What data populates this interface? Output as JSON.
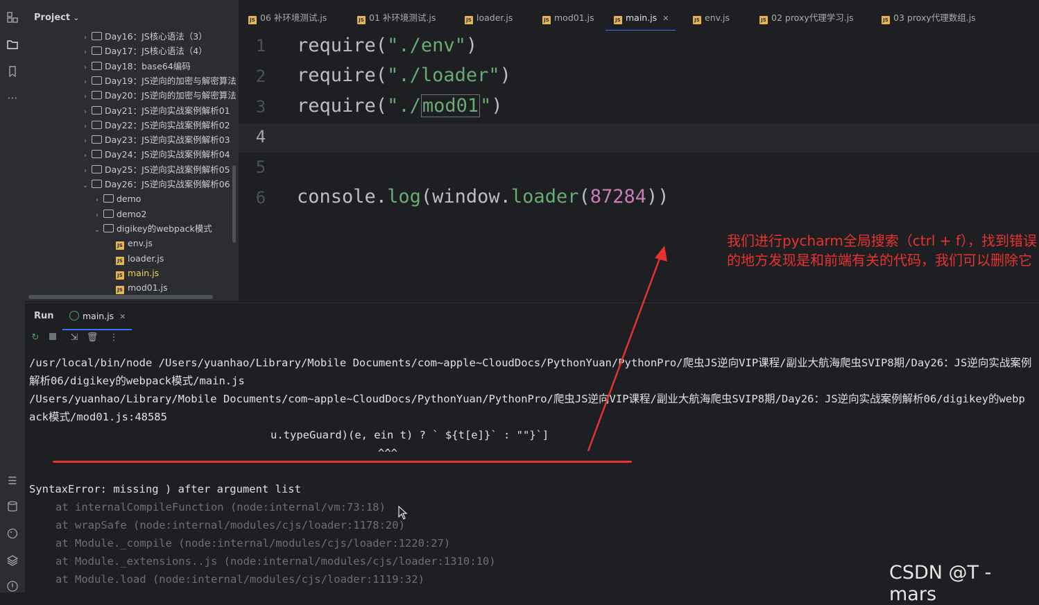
{
  "project": {
    "title": "Project"
  },
  "tree": [
    {
      "label": "Day16：JS核心语法（3）",
      "type": "folder",
      "open": false
    },
    {
      "label": "Day17：JS核心语法（4）",
      "type": "folder",
      "open": false
    },
    {
      "label": "Day18：base64编码",
      "type": "folder",
      "open": false
    },
    {
      "label": "Day19：JS逆向的加密与解密算法",
      "type": "folder",
      "open": false
    },
    {
      "label": "Day20：JS逆向的加密与解密算法",
      "type": "folder",
      "open": false
    },
    {
      "label": "Day21：JS逆向实战案例解析01",
      "type": "folder",
      "open": false
    },
    {
      "label": "Day22：JS逆向实战案例解析02",
      "type": "folder",
      "open": false
    },
    {
      "label": "Day23：JS逆向实战案例解析03",
      "type": "folder",
      "open": false
    },
    {
      "label": "Day24：JS逆向实战案例解析04",
      "type": "folder",
      "open": false
    },
    {
      "label": "Day25：JS逆向实战案例解析05",
      "type": "folder",
      "open": false
    },
    {
      "label": "Day26：JS逆向实战案例解析06",
      "type": "folder",
      "open": true
    },
    {
      "label": "demo",
      "type": "folder",
      "open": false
    },
    {
      "label": "demo2",
      "type": "folder",
      "open": false
    },
    {
      "label": "digikey的webpack模式",
      "type": "folder",
      "open": true
    },
    {
      "label": "env.js",
      "type": "file"
    },
    {
      "label": "loader.js",
      "type": "file"
    },
    {
      "label": "main.js",
      "type": "file",
      "active": true
    },
    {
      "label": "mod01.js",
      "type": "file"
    }
  ],
  "tabs": [
    {
      "label": "06 补环境测试.js"
    },
    {
      "label": "01 补环境测试.js"
    },
    {
      "label": "loader.js"
    },
    {
      "label": "mod01.js"
    },
    {
      "label": "main.js",
      "active": true
    },
    {
      "label": "env.js"
    },
    {
      "label": "02 proxy代理学习.js"
    },
    {
      "label": "03 proxy代理数组.js"
    }
  ],
  "editor": {
    "line_numbers": [
      "1",
      "2",
      "3",
      "4",
      "5",
      "6"
    ],
    "current_line": "4",
    "lines": {
      "l1": {
        "fn": "require",
        "open": "(",
        "str": "\"./env\"",
        "close": ")"
      },
      "l2": {
        "fn": "require",
        "open": "(",
        "str": "\"./loader\"",
        "close": ")"
      },
      "l3": {
        "fn": "require",
        "open": "(",
        "str_a": "\"./",
        "str_b": "mod01",
        "str_c": "\"",
        "close": ")"
      },
      "l6": {
        "obj": "console",
        "dot1": ".",
        "method": "log",
        "open1": "(",
        "arg": "window",
        "dot2": ".",
        "prop": "loader",
        "open2": "(",
        "num": "87284",
        "close": "))"
      }
    }
  },
  "annotation": "我们进行pycharm全局搜索（ctrl + f），找到错误的地方发现是和前端有关的代码，我们可以删除它",
  "run": {
    "title": "Run",
    "tab_label": "main.js",
    "console": {
      "line1": "/usr/local/bin/node /Users/yuanhao/Library/Mobile Documents/com~apple~CloudDocs/PythonYuan/PythonPro/爬虫JS逆向VIP课程/副业大航海爬虫SVIP8期/Day26：JS逆向实战案例",
      "line2": "解析06/digikey的webpack模式/main.js",
      "line3": "/Users/yuanhao/Library/Mobile Documents/com~apple~CloudDocs/PythonYuan/PythonPro/爬虫JS逆向VIP课程/副业大航海爬虫SVIP8期/Day26：JS逆向实战案例解析06/digikey的webp",
      "line4": "ack模式/mod01.js:48585",
      "line5": "u.typeGuard)(e, ein t) ? ` ${t[e]}` : \"\"}`]",
      "line6": "^^^",
      "error": "SyntaxError: missing ) after argument list",
      "trace": [
        "at internalCompileFunction (node:internal/vm:73:18)",
        "at wrapSafe (node:internal/modules/cjs/loader:1178:20)",
        "at Module._compile (node:internal/modules/cjs/loader:1220:27)",
        "at Module._extensions..js (node:internal/modules/cjs/loader:1310:10)",
        "at Module.load (node:internal/modules/cjs/loader:1119:32)"
      ]
    }
  },
  "watermark": "CSDN @T - mars",
  "colors": {
    "accent": "#3574f0",
    "annotation": "#e8322f",
    "string": "#6aab73",
    "function": "#56a8f5"
  }
}
